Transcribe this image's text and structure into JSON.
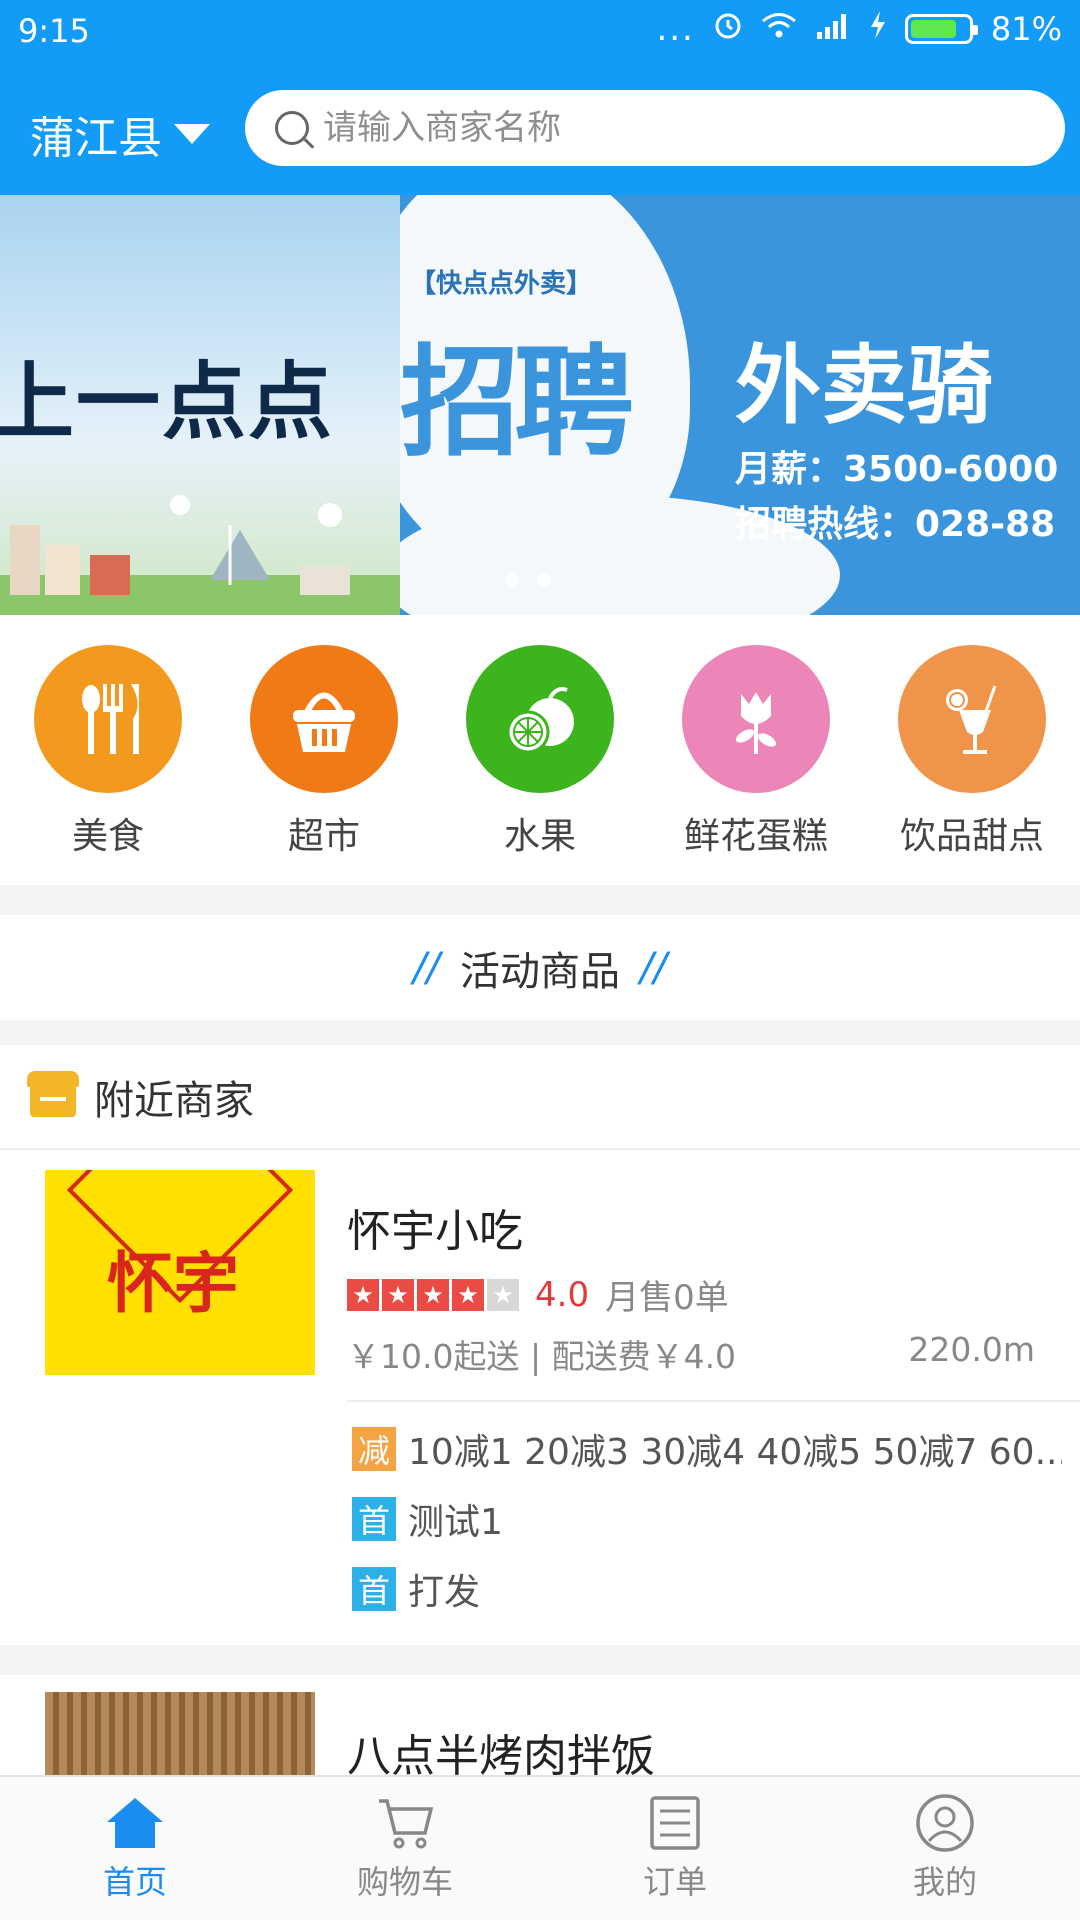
{
  "status_bar": {
    "time": "9:15",
    "battery": "81%",
    "battery_level": 0.81,
    "dots": "..."
  },
  "header": {
    "city": "蒲江县",
    "search_placeholder": "请输入商家名称"
  },
  "banner": {
    "left_text": "上一点点",
    "tag": "【快点点外卖】",
    "headline": "招聘",
    "subhead": "外卖骑",
    "salary": "月薪：3500-6000",
    "hotline": "招聘热线：028-88",
    "active_index": 1,
    "count": 2
  },
  "categories": [
    {
      "label": "美食",
      "icon": "utensils-icon",
      "color": "#f39a1e"
    },
    {
      "label": "超市",
      "icon": "basket-icon",
      "color": "#f07b16"
    },
    {
      "label": "水果",
      "icon": "fruit-icon",
      "color": "#3db41e"
    },
    {
      "label": "鲜花蛋糕",
      "icon": "flower-icon",
      "color": "#ec86b8"
    },
    {
      "label": "饮品甜点",
      "icon": "drink-icon",
      "color": "#f0944a"
    }
  ],
  "activity": {
    "slash_left": "//",
    "title": "活动商品",
    "slash_right": "//"
  },
  "nearby": {
    "title": "附近商家",
    "stores": [
      {
        "name": "怀宇小吃",
        "logo_text": "怀宇",
        "rating": "4.0",
        "stars": 4,
        "monthly_sales": "月售0单",
        "delivery": "￥10.0起送 | 配送费￥4.0",
        "distance": "220.0m",
        "promotions": [
          {
            "badge": "减",
            "badge_color": "#f5a443",
            "text": "10减1 20减3 30减4 40减5 50减7 60..."
          },
          {
            "badge": "首",
            "badge_color": "#2bb1e8",
            "text": "测试1"
          },
          {
            "badge": "首",
            "badge_color": "#2bb1e8",
            "text": "打发"
          }
        ]
      },
      {
        "name": "八点半烤肉拌饭"
      }
    ]
  },
  "tabbar": {
    "tabs": [
      {
        "label": "首页",
        "icon": "home-icon",
        "active": true
      },
      {
        "label": "购物车",
        "icon": "cart-icon",
        "active": false
      },
      {
        "label": "订单",
        "icon": "order-icon",
        "active": false
      },
      {
        "label": "我的",
        "icon": "profile-icon",
        "active": false
      }
    ]
  },
  "colors": {
    "primary": "#129bf7",
    "accent": "#1b8df0",
    "rating": "#e4393c"
  }
}
